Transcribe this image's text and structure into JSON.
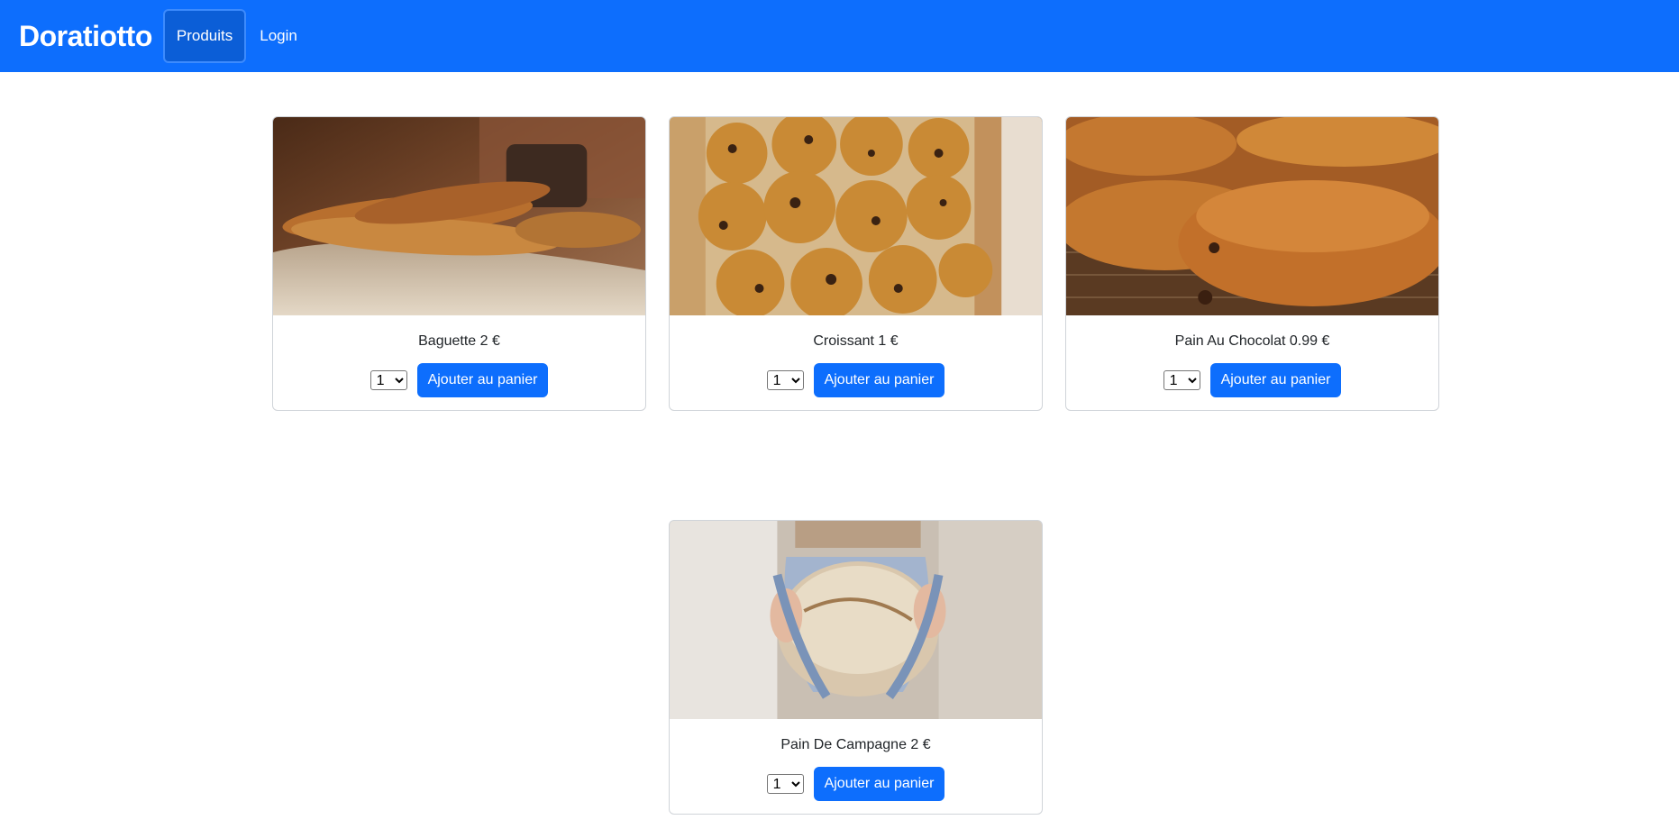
{
  "nav": {
    "brand": "Doratiotto",
    "links": [
      {
        "label": "Produits",
        "active": true
      },
      {
        "label": "Login",
        "active": false
      }
    ]
  },
  "products": [
    {
      "title": "Baguette 2 €",
      "qty": "1",
      "button": "Ajouter au panier",
      "image": "baguettes-photo"
    },
    {
      "title": "Croissant 1 €",
      "qty": "1",
      "button": "Ajouter au panier",
      "image": "brioches-chocolate-chip-photo"
    },
    {
      "title": "Pain Au Chocolat 0.99 €",
      "qty": "1",
      "button": "Ajouter au panier",
      "image": "pain-au-chocolat-photo"
    },
    {
      "title": "Pain De Campagne 2 €",
      "qty": "1",
      "button": "Ajouter au panier",
      "image": "country-bread-photo"
    }
  ],
  "colors": {
    "primary": "#0d6efd",
    "nav_active": "#0b5ed7"
  }
}
